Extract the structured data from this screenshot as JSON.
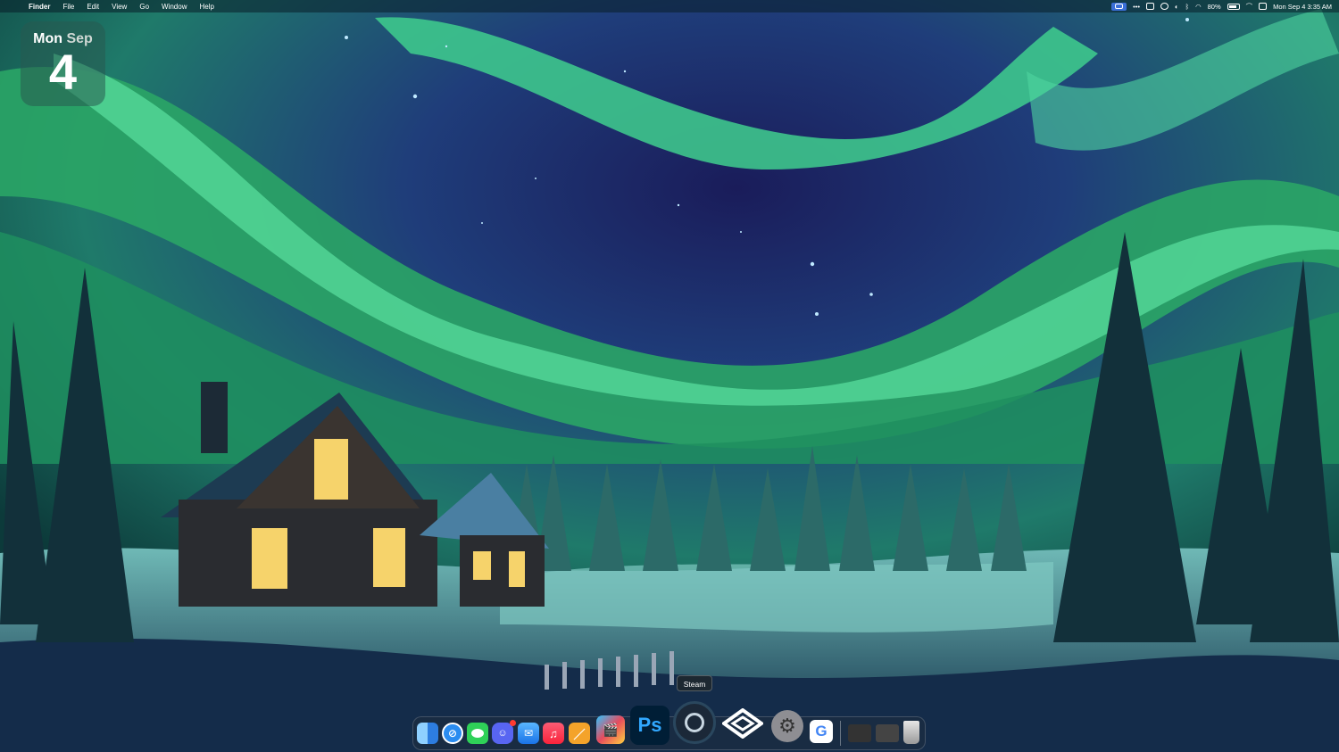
{
  "menubar": {
    "apple_glyph": "",
    "app_name": "Finder",
    "menus": [
      "File",
      "Edit",
      "View",
      "Go",
      "Window",
      "Help"
    ],
    "battery_percent": "80%",
    "clock": "Mon Sep 4  3:35 AM",
    "status_icons": [
      "screen-mirroring-icon",
      "more-icon",
      "clipboard-icon",
      "screenshot-icon",
      "sound-icon",
      "bluetooth-icon",
      "wifi-icon",
      "battery-icon",
      "vpn-icon",
      "control-center-icon"
    ]
  },
  "calendar_widget": {
    "weekday": "Mon",
    "month": "Sep",
    "day": "4"
  },
  "tooltip": {
    "text": "Steam"
  },
  "dock": {
    "items": [
      {
        "name": "finder",
        "color": "#4aa3ff"
      },
      {
        "name": "safari",
        "color": "#2a8cf0"
      },
      {
        "name": "messages",
        "color": "#2fd158"
      },
      {
        "name": "discord",
        "color": "#5865f2"
      },
      {
        "name": "mail",
        "color": "#3aa0ff"
      },
      {
        "name": "music",
        "color": "#fa3c5a"
      },
      {
        "name": "pages",
        "color": "#f4a32a"
      },
      {
        "name": "claquette",
        "color": "#e84b5e"
      },
      {
        "name": "photoshop",
        "color": "#001e36",
        "label": "Ps"
      },
      {
        "name": "steam",
        "color": "#1b2838"
      },
      {
        "name": "perplexity",
        "color": "#222"
      },
      {
        "name": "system-settings",
        "color": "#8e8e93"
      },
      {
        "name": "google",
        "color": "#ffffff",
        "label": "G"
      },
      {
        "name": "downloads-stack",
        "color": "#333"
      },
      {
        "name": "screenshot-stack",
        "color": "#444"
      },
      {
        "name": "trash",
        "color": "#c8c8c8"
      }
    ]
  }
}
